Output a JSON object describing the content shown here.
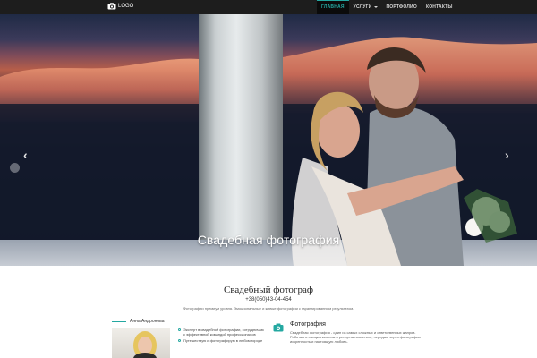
{
  "navbar": {
    "logo_text": "LOGO",
    "items": [
      {
        "label": "ГЛАВНАЯ",
        "active": true
      },
      {
        "label": "УСЛУГИ",
        "dropdown": true
      },
      {
        "label": "ПОРТФОЛИО"
      },
      {
        "label": "КОНТАКТЫ"
      }
    ]
  },
  "hero": {
    "caption": "Свадебная фотография",
    "slides_count": 4,
    "active_slide": 1
  },
  "main": {
    "title": "Свадебный фотограф",
    "phone": "+38(050)43-04-454",
    "tagline": "Фотографии премиум уровня. Эмоциональные и живые фотографии с гарантированным результатом."
  },
  "photographer": {
    "name": "Анна Андронова",
    "bullets": [
      "Эксперт в свадебной фотографии, сотрудничаю с эффективной командой профессионалов",
      "Путешествую и фотографирую в любом городе"
    ]
  },
  "feature": {
    "title": "Фотография",
    "text": "Свадебная фотография - один из самых сложных и ответственных жанров. Работаю в эмоциональном и репортажном стиле, передаю через фотографии искренность и настоящую любовь."
  },
  "colors": {
    "accent": "#24a8a1",
    "navbar_bg": "#1d1d1d"
  }
}
